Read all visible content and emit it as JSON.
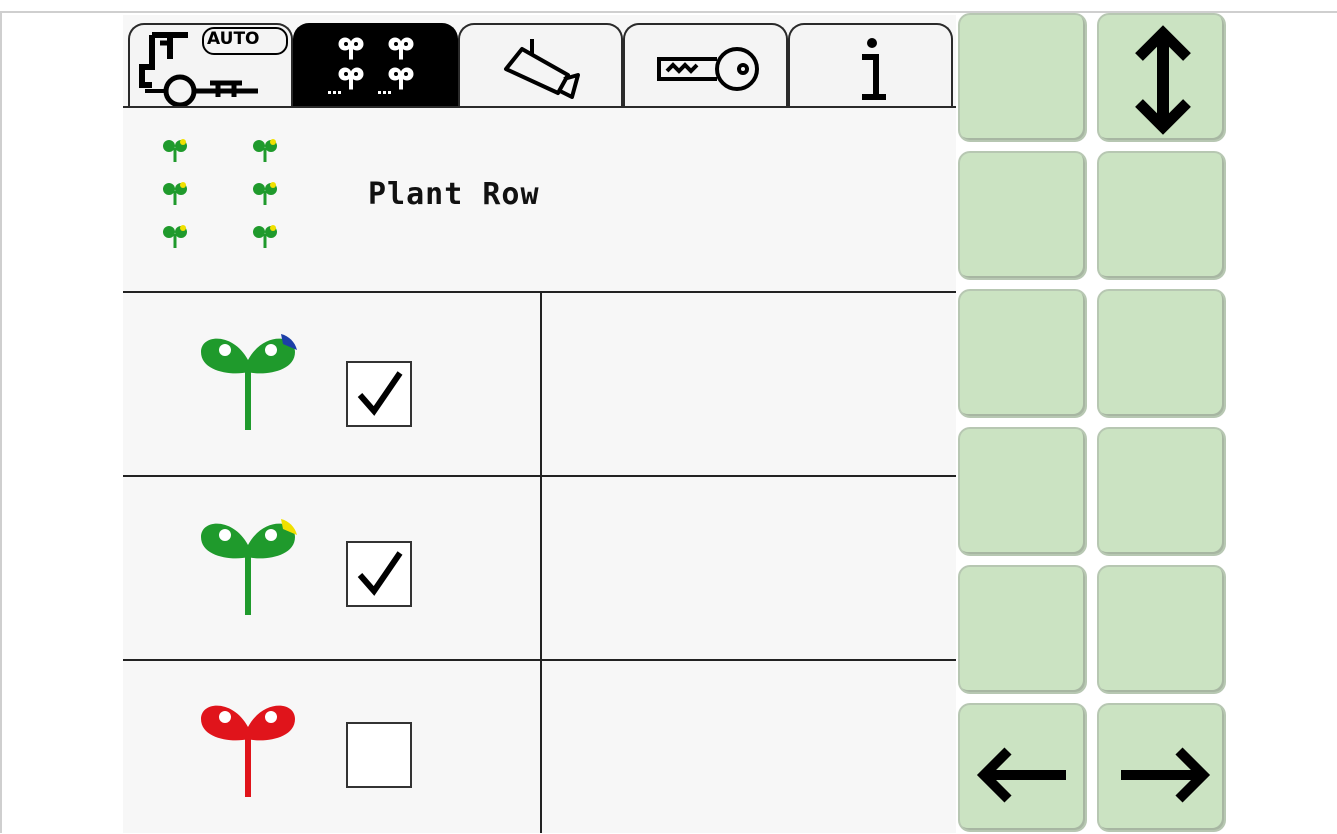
{
  "tabs": [
    {
      "name": "auto-tractor",
      "text": "AUTO",
      "active": false
    },
    {
      "name": "plant-rows",
      "active": true
    },
    {
      "name": "camera",
      "active": false
    },
    {
      "name": "key",
      "active": false
    },
    {
      "name": "info",
      "active": false
    }
  ],
  "header": {
    "title": "Plant Row",
    "icon": "plant-grid-icon"
  },
  "rows": [
    {
      "icon": "plant-green-blue-icon",
      "checked": true
    },
    {
      "icon": "plant-green-yellow-icon",
      "checked": true
    },
    {
      "icon": "plant-red-icon",
      "checked": false
    }
  ],
  "softkeys": {
    "top_right_icon": "up-down-arrow-icon",
    "bottom_left_icon": "arrow-left-icon",
    "bottom_right_icon": "arrow-right-icon"
  },
  "colors": {
    "softkey": "#cbe3c2",
    "plant_green": "#1f9a2c",
    "plant_red": "#e0141b",
    "accent_yellow": "#f0e000",
    "accent_blue": "#1c3fa8"
  }
}
